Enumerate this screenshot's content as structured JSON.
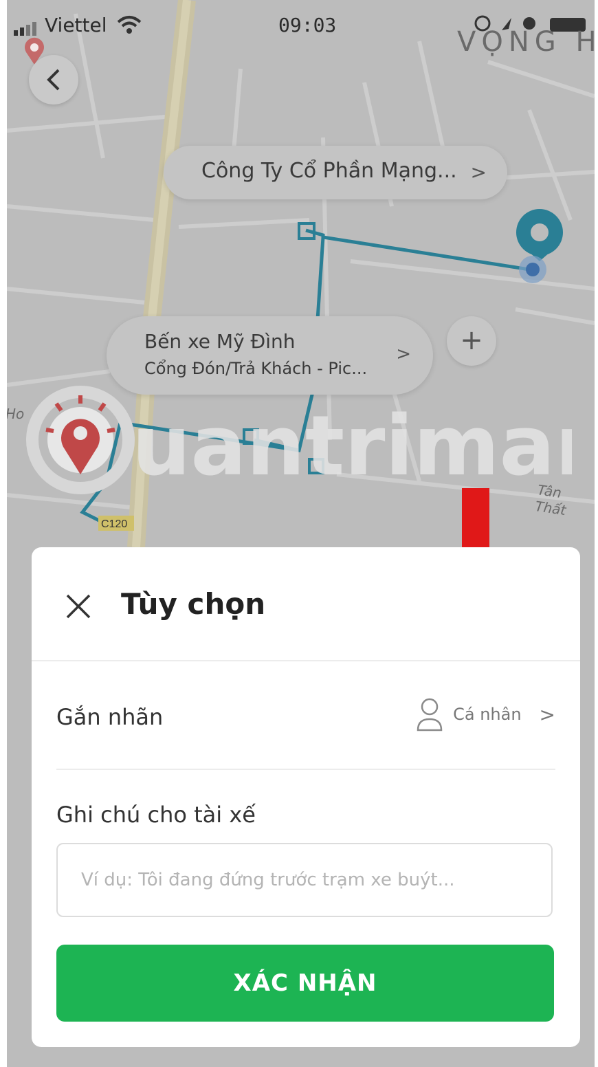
{
  "status_bar": {
    "carrier": "Viettel",
    "time": "09:03"
  },
  "map": {
    "area_label": "VỌNG H",
    "road_label": "Tân Thất",
    "road_label_left": "Ho",
    "route_badge": "C120",
    "watermark_text": "uantrimang",
    "destination_pill": {
      "title": "Công Ty Cổ Phần Mạng...",
      "chevron": ">"
    },
    "stop_pill": {
      "title": "Bến xe Mỹ Đình",
      "subtitle": "Cổng Đón/Trả Khách - Pic...",
      "chevron": ">"
    },
    "add_stop_label": "+",
    "colors": {
      "route": "#2a7f95",
      "pin": "#2a7f95",
      "arrow": "#e01818"
    }
  },
  "sheet": {
    "title": "Tùy chọn",
    "tag_row": {
      "label": "Gắn nhãn",
      "value": "Cá nhân",
      "chevron": ">"
    },
    "note": {
      "label": "Ghi chú cho tài xế",
      "placeholder": "Ví dụ: Tôi đang đứng trước trạm xe buýt..."
    },
    "confirm_label": "XÁC NHẬN",
    "colors": {
      "confirm_bg": "#1db453"
    }
  }
}
